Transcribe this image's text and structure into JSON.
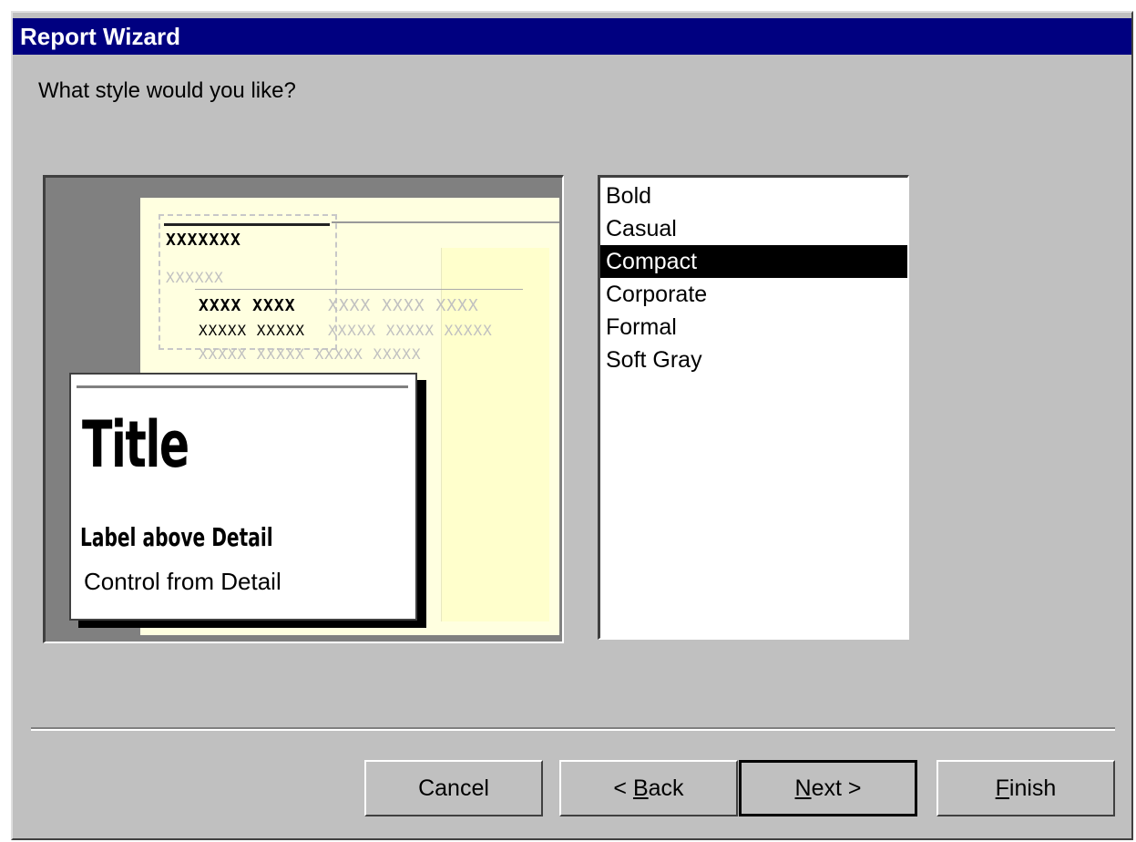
{
  "window": {
    "title": "Report Wizard"
  },
  "prompt": "What style would you like?",
  "preview": {
    "sample_header": "XXXXXXX",
    "sample_faint_header": "XXXXXX",
    "sample_row1": "XXXX XXXX",
    "sample_row1_faint": "XXXX XXXX XXXX",
    "sample_row2": "XXXXX XXXXX",
    "sample_row2_faint": "XXXXX XXXXX XXXXX",
    "sample_row3_faint": "XXXXX XXXXX XXXXX XXXXX",
    "callout": {
      "title": "Title",
      "label": "Label above Detail",
      "control": "Control from Detail"
    }
  },
  "styles": {
    "items": [
      "Bold",
      "Casual",
      "Compact",
      "Corporate",
      "Formal",
      "Soft Gray"
    ],
    "selected": "Compact"
  },
  "buttons": {
    "cancel": "Cancel",
    "back_prefix": "< ",
    "back_mnemonic": "B",
    "back_rest": "ack",
    "next_mnemonic": "N",
    "next_rest": "ext >",
    "finish_mnemonic": "F",
    "finish_rest": "inish"
  }
}
